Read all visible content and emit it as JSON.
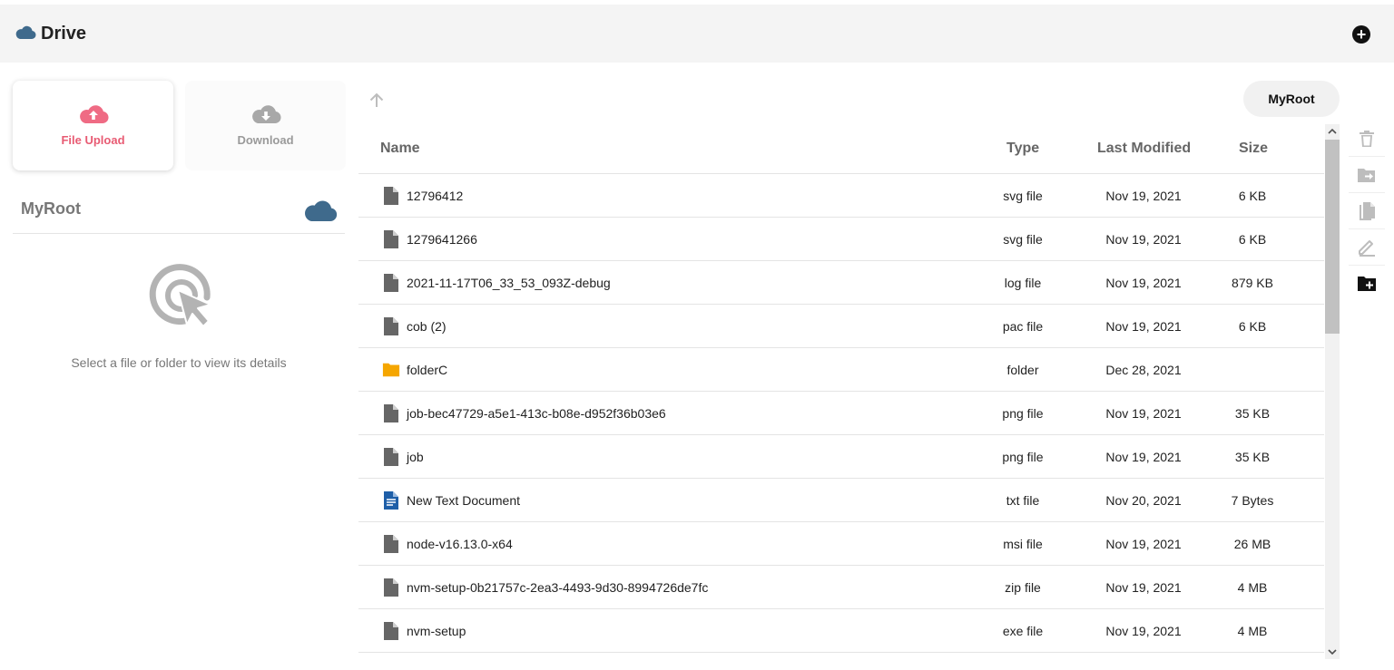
{
  "header": {
    "title": "Drive",
    "brand_icon": "cloud-icon",
    "add_icon": "plus-circle-icon",
    "add_symbol": "+"
  },
  "actions": {
    "upload_label": "File Upload",
    "upload_icon": "cloud-upload-icon",
    "download_label": "Download",
    "download_icon": "cloud-download-icon"
  },
  "details": {
    "title": "MyRoot",
    "icon": "cloud-icon",
    "empty_icon": "cursor-click-icon",
    "empty_text": "Select a file or folder to view its details"
  },
  "navigation": {
    "up_icon": "arrow-up-icon",
    "breadcrumb": "MyRoot"
  },
  "table": {
    "columns": {
      "name": "Name",
      "type": "Type",
      "modified": "Last Modified",
      "size": "Size"
    },
    "rows": [
      {
        "icon": "file-icon",
        "name": "12796412",
        "type": "svg file",
        "modified": "Nov 19, 2021",
        "size": "6 KB"
      },
      {
        "icon": "file-icon",
        "name": "1279641266",
        "type": "svg file",
        "modified": "Nov 19, 2021",
        "size": "6 KB"
      },
      {
        "icon": "file-icon",
        "name": "2021-11-17T06_33_53_093Z-debug",
        "type": "log file",
        "modified": "Nov 19, 2021",
        "size": "879 KB"
      },
      {
        "icon": "file-icon",
        "name": "cob (2)",
        "type": "pac file",
        "modified": "Nov 19, 2021",
        "size": "6 KB"
      },
      {
        "icon": "folder-icon",
        "name": "folderC",
        "type": "folder",
        "modified": "Dec 28, 2021",
        "size": ""
      },
      {
        "icon": "file-icon",
        "name": "job-bec47729-a5e1-413c-b08e-d952f36b03e6",
        "type": "png file",
        "modified": "Nov 19, 2021",
        "size": "35 KB"
      },
      {
        "icon": "file-icon",
        "name": "job",
        "type": "png file",
        "modified": "Nov 19, 2021",
        "size": "35 KB"
      },
      {
        "icon": "text-document-icon",
        "name": "New Text Document",
        "type": "txt file",
        "modified": "Nov 20, 2021",
        "size": "7 Bytes"
      },
      {
        "icon": "file-icon",
        "name": "node-v16.13.0-x64",
        "type": "msi file",
        "modified": "Nov 19, 2021",
        "size": "26 MB"
      },
      {
        "icon": "file-icon",
        "name": "nvm-setup-0b21757c-2ea3-4493-9d30-8994726de7fc",
        "type": "zip file",
        "modified": "Nov 19, 2021",
        "size": "4 MB"
      },
      {
        "icon": "file-icon",
        "name": "nvm-setup",
        "type": "exe file",
        "modified": "Nov 19, 2021",
        "size": "4 MB"
      }
    ]
  },
  "side_tools": [
    "delete-icon",
    "move-icon",
    "copy-icon",
    "rename-icon",
    "new-folder-icon"
  ],
  "colors": {
    "brand_cloud": "#3f6a8c",
    "upload_accent": "#e85b73",
    "folder": "#f5a600",
    "text_document": "#1e5fa8",
    "file_icon": "#666666",
    "disabled": "#bdbdbd"
  }
}
